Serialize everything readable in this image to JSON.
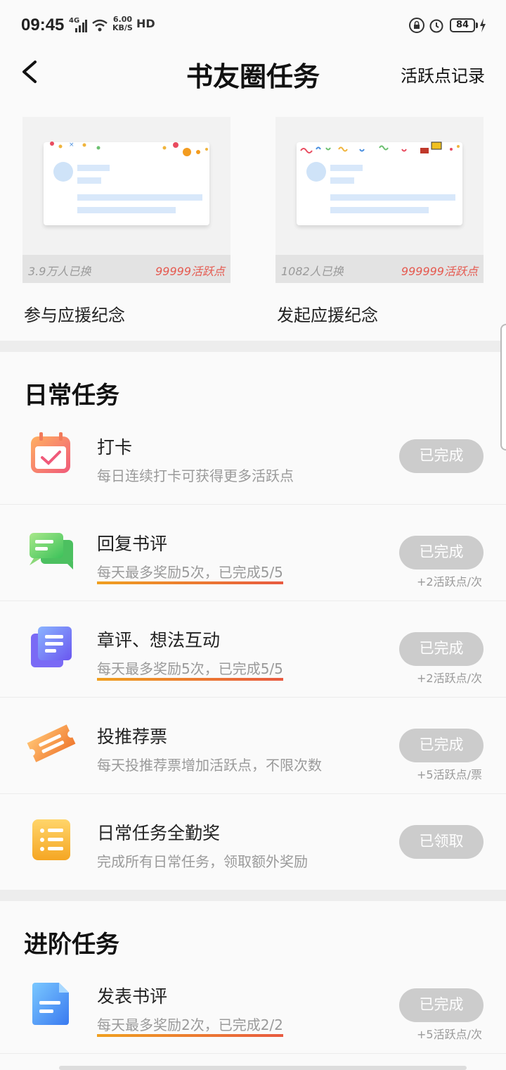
{
  "status_bar": {
    "time": "09:45",
    "network": "4G",
    "speed_value": "6.00",
    "speed_unit": "KB/S",
    "hd": "HD",
    "battery": "84"
  },
  "header": {
    "title": "书友圈任务",
    "record_link": "活跃点记录"
  },
  "cards": [
    {
      "count": "3.9万人已换",
      "points": "99999活跃点",
      "label": "参与应援纪念"
    },
    {
      "count": "1082人已换",
      "points": "999999活跃点",
      "label": "发起应援纪念"
    }
  ],
  "daily": {
    "title": "日常任务",
    "tasks": [
      {
        "name": "打卡",
        "desc": "每日连续打卡可获得更多活跃点",
        "button": "已完成",
        "reward": "",
        "icon": "calendar-icon"
      },
      {
        "name": "回复书评",
        "desc": "每天最多奖励5次，已完成5/5",
        "button": "已完成",
        "reward": "+2活跃点/次",
        "icon": "chat-icon"
      },
      {
        "name": "章评、想法互动",
        "desc": "每天最多奖励5次，已完成5/5",
        "button": "已完成",
        "reward": "+2活跃点/次",
        "icon": "notes-icon"
      },
      {
        "name": "投推荐票",
        "desc": "每天投推荐票增加活跃点，不限次数",
        "button": "已完成",
        "reward": "+5活跃点/票",
        "icon": "ticket-icon"
      },
      {
        "name": "日常任务全勤奖",
        "desc": "完成所有日常任务，领取额外奖励",
        "button": "已领取",
        "reward": "",
        "icon": "list-icon"
      }
    ]
  },
  "advanced": {
    "title": "进阶任务",
    "tasks": [
      {
        "name": "发表书评",
        "desc": "每天最多奖励2次，已完成2/2",
        "button": "已完成",
        "reward": "+5活跃点/次",
        "icon": "document-icon"
      }
    ]
  },
  "colors": {
    "button_done": "#cccccc",
    "points_red": "#e55a50",
    "underline_start": "#f0a020",
    "underline_end": "#e85a40"
  }
}
